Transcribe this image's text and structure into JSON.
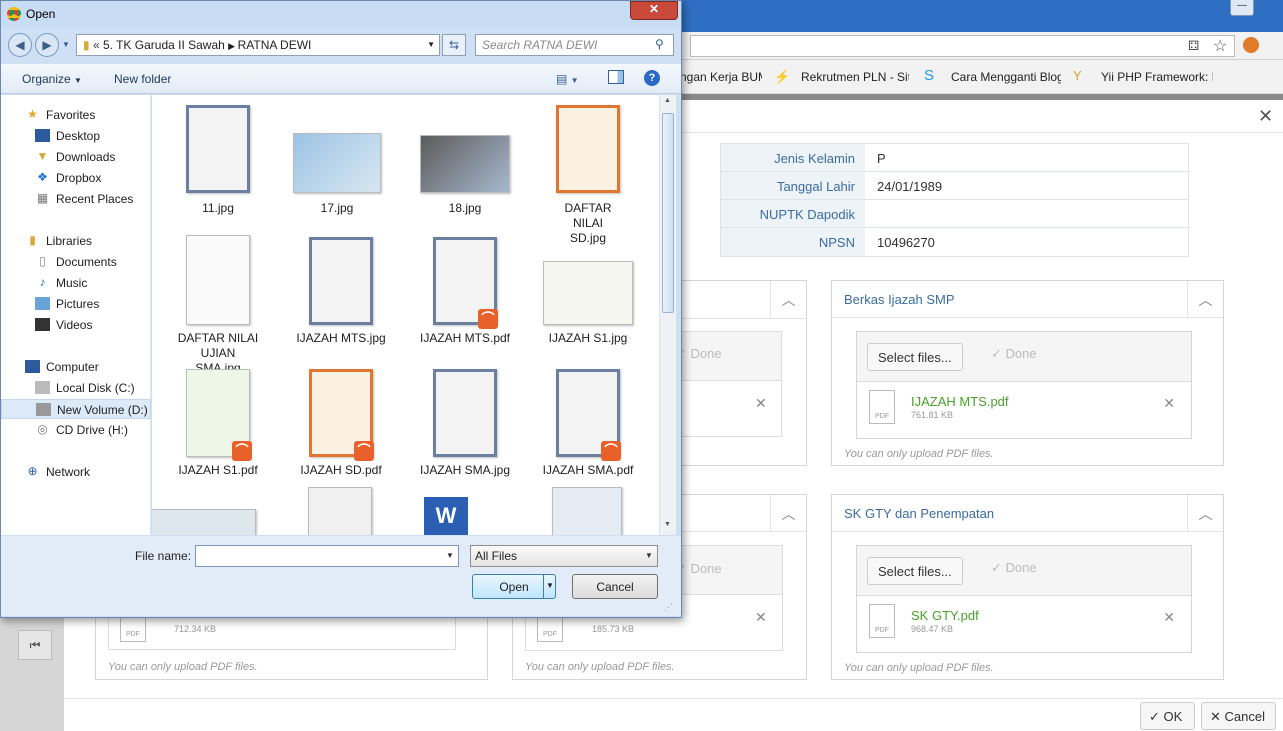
{
  "browser": {
    "bookmarks": [
      "ngan Kerja BUM",
      "Rekrutmen PLN - Sit",
      "Cara Mengganti Blog",
      "Yii PHP Framework: E"
    ]
  },
  "form": {
    "info": [
      {
        "label": "Jenis Kelamin",
        "value": "P"
      },
      {
        "label": "Tanggal Lahir",
        "value": "24/01/1989"
      },
      {
        "label": "NUPTK Dapodik",
        "value": ""
      },
      {
        "label": "NPSN",
        "value": "10496270"
      }
    ],
    "panels": {
      "smp": {
        "title": "Berkas Ijazah SMP",
        "select": "Select files...",
        "done": "Done",
        "file": "IJAZAH MTS.pdf",
        "size": "761.81 KB",
        "hint": "You can only upload PDF files."
      },
      "sk": {
        "title": "SK GTY dan Penempatan",
        "select": "Select files...",
        "done": "Done",
        "file": "SK GTY.pdf",
        "size": "968.47 KB",
        "hint": "You can only upload PDF files."
      },
      "left_top": {
        "done": "Done"
      },
      "left_bottom": {
        "size": "712.34 KB",
        "hint": "You can only upload PDF files."
      },
      "mid_bottom": {
        "done": "Done",
        "size": "185.73 KB",
        "hint": "You can only upload PDF files."
      }
    },
    "ok": "OK",
    "cancel": "Cancel"
  },
  "dialog": {
    "title": "Open",
    "breadcrumb": [
      "5. TK Garuda II Sawah",
      "RATNA DEWI"
    ],
    "search_placeholder": "Search RATNA DEWI",
    "toolbar": {
      "organize": "Organize",
      "new_folder": "New folder"
    },
    "nav": {
      "favorites": "Favorites",
      "fav_items": [
        "Desktop",
        "Downloads",
        "Dropbox",
        "Recent Places"
      ],
      "libraries": "Libraries",
      "lib_items": [
        "Documents",
        "Music",
        "Pictures",
        "Videos"
      ],
      "computer": "Computer",
      "comp_items": [
        "Local Disk (C:)",
        "New Volume (D:)",
        "CD Drive (H:)"
      ],
      "network": "Network"
    },
    "files": [
      "11.jpg",
      "17.jpg",
      "18.jpg",
      "DAFTAR NILAI SD.jpg",
      "DAFTAR NILAI UJIAN SMA.jpg",
      "IJAZAH MTS.jpg",
      "IJAZAH MTS.pdf",
      "IJAZAH S1.jpg",
      "IJAZAH S1.pdf",
      "IJAZAH SD.pdf",
      "IJAZAH SMA.jpg",
      "IJAZAH SMA.pdf"
    ],
    "file_name_label": "File name:",
    "file_name_value": "",
    "file_type": "All Files",
    "open": "Open",
    "cancel": "Cancel",
    "colors": {
      "pdf_badge": "#e8612a",
      "close": "#c94a3b"
    }
  }
}
